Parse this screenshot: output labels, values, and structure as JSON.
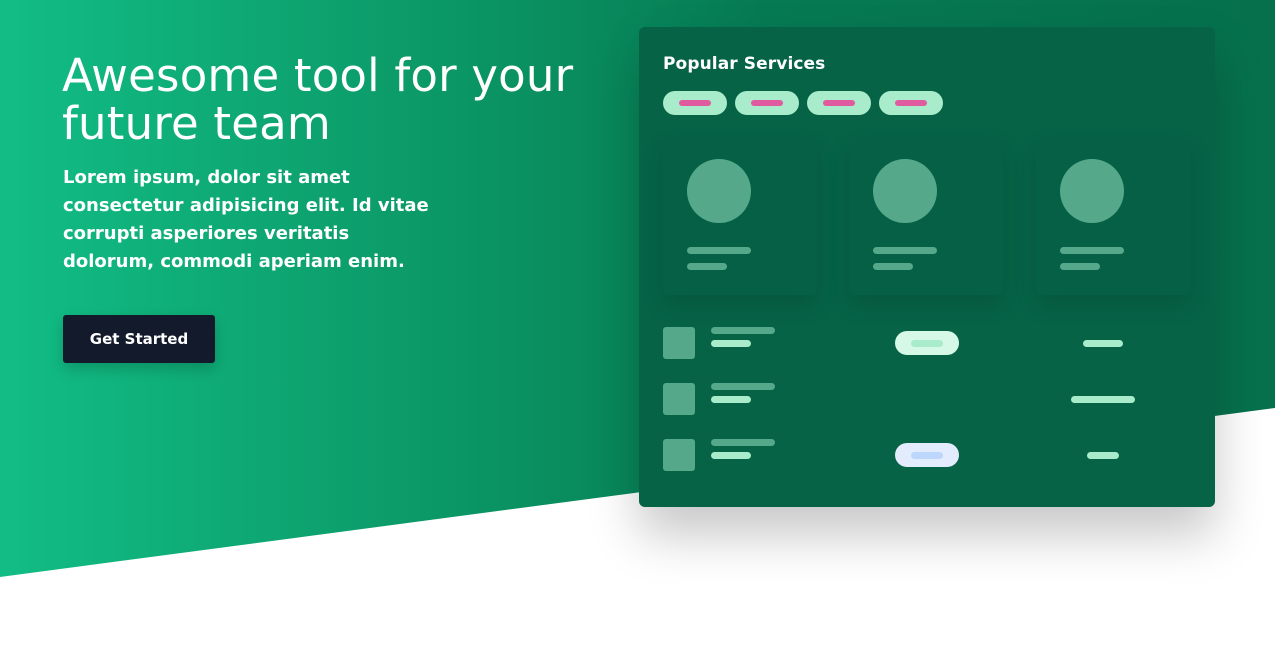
{
  "hero": {
    "title": "Awesome tool for your future team",
    "description": "Lorem ipsum, dolor sit amet consectetur adipisicing elit. Id vitae corrupti asperiores veritatis dolorum, commodi aperiam enim.",
    "cta_label": "Get Started"
  },
  "dashboard": {
    "title": "Popular Services"
  },
  "colors": {
    "gradient_start": "#12bd85",
    "gradient_end": "#06704c",
    "card_bg": "#066346",
    "button_bg": "#121a2c",
    "chip_bg": "#a8eccc",
    "chip_accent": "#e05aa0",
    "placeholder": "#55a98a",
    "status_green": "#d6f8e7",
    "status_blue": "#e3ecfc"
  }
}
